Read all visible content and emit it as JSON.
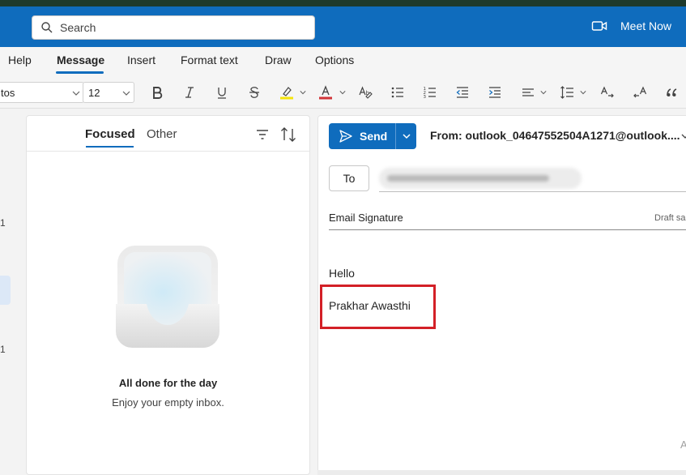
{
  "header": {
    "search_placeholder": "Search",
    "meet_now_label": "Meet Now"
  },
  "ribbon": {
    "tabs": [
      "Help",
      "Message",
      "Insert",
      "Format text",
      "Draw",
      "Options"
    ],
    "active_tab": "Message"
  },
  "toolbar": {
    "font_name": "tos",
    "font_size": "12",
    "buttons": [
      "bold",
      "italic",
      "underline",
      "strikethrough",
      "highlight",
      "font-color",
      "styles",
      "bullets",
      "numbering",
      "decrease-indent",
      "increase-indent",
      "align",
      "line-spacing",
      "text-direction-ltr",
      "text-direction-rtl",
      "quote"
    ]
  },
  "left_rail": {
    "numbers": [
      "1",
      "1"
    ]
  },
  "message_list": {
    "tab_focused": "Focused",
    "tab_other": "Other",
    "empty_title": "All done for the day",
    "empty_subtitle": "Enjoy your empty inbox."
  },
  "compose": {
    "send_label": "Send",
    "from_label": "From: outlook_04647552504A1271@outlook....",
    "to_label": "To",
    "subject": "Email Signature",
    "draft_status": "Draft sa",
    "body_greeting": "Hello",
    "body_signature": "Prakhar Awasthi",
    "corner_glyph": "A"
  },
  "colors": {
    "brand_blue": "#0f6cbd",
    "highlight_box": "#d32027",
    "highlighter_yellow": "#f5e50a",
    "font_color_red": "#d13438"
  }
}
